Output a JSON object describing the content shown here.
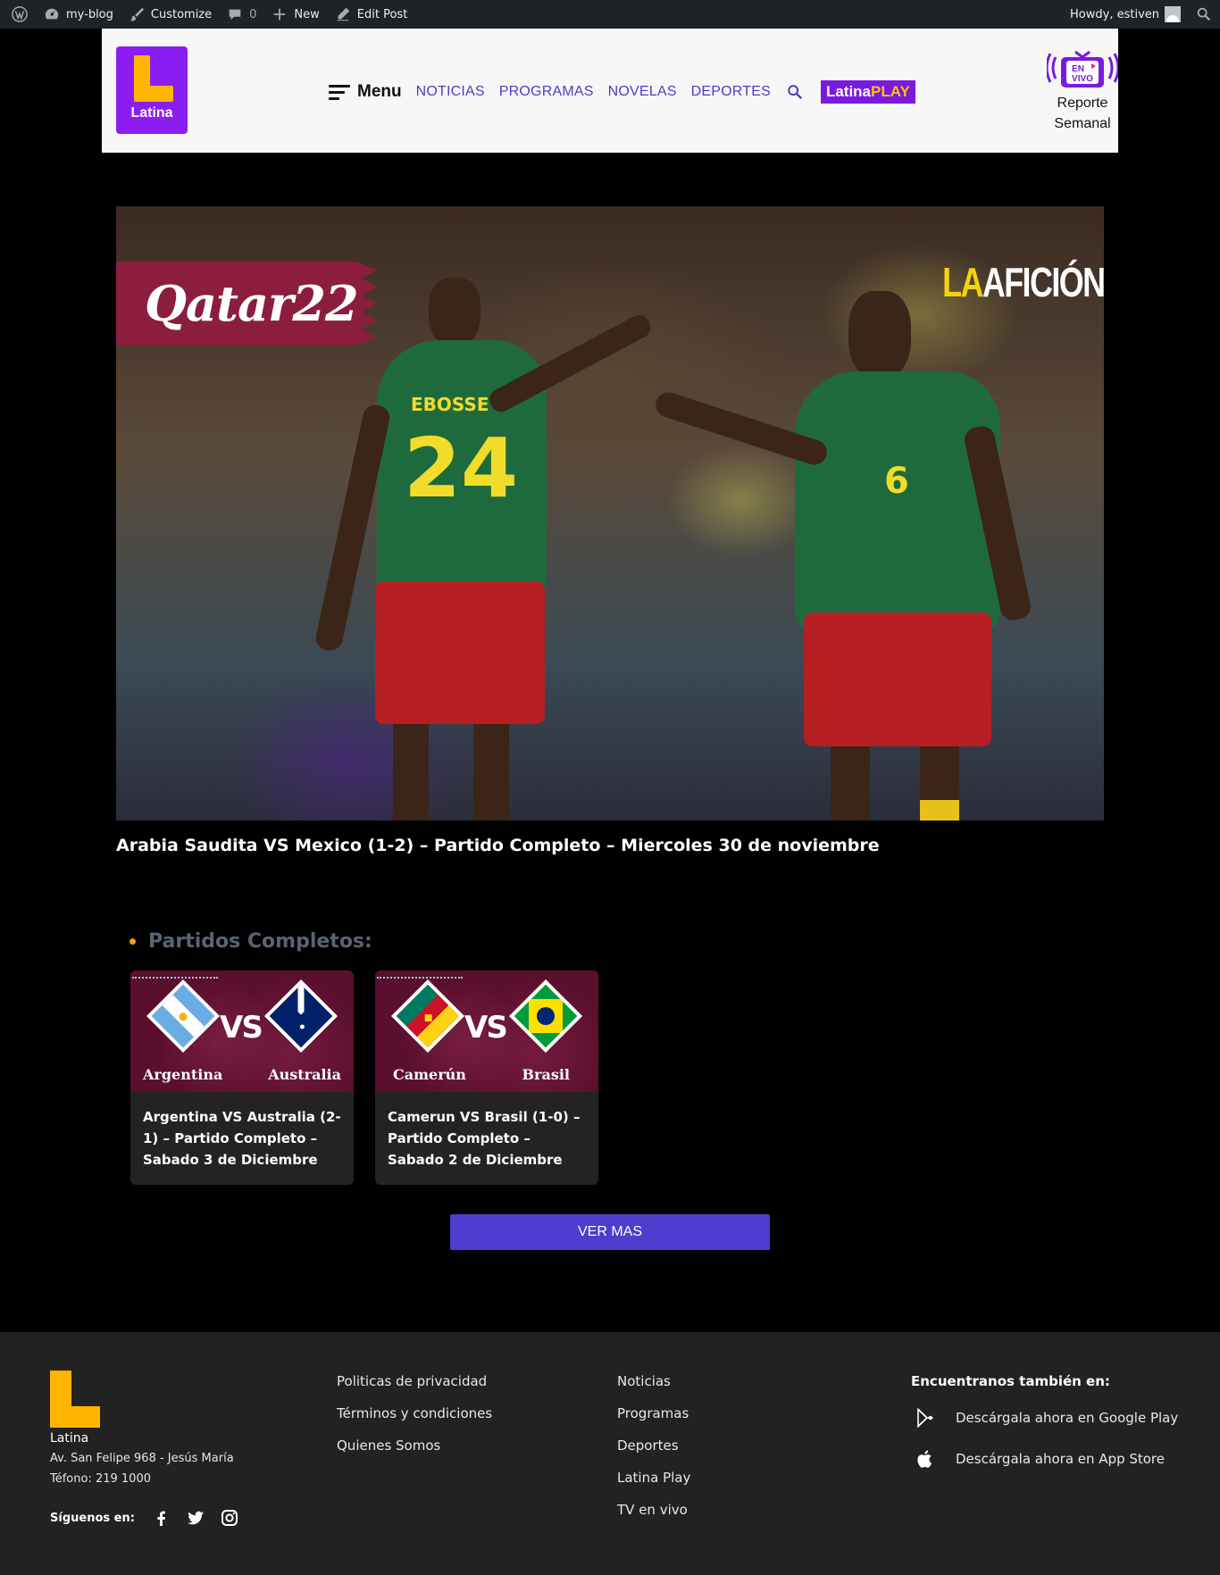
{
  "adminbar": {
    "site": "my-blog",
    "customize": "Customize",
    "comments_count": "0",
    "new": "New",
    "edit": "Edit Post",
    "howdy": "Howdy, estiven"
  },
  "header": {
    "logo_text": "Latina",
    "menu_label": "Menu",
    "nav": [
      "NOTICIAS",
      "PROGRAMAS",
      "NOVELAS",
      "DEPORTES"
    ],
    "latina_play": {
      "latina": "Latina",
      "play": "PLAY"
    },
    "en_vivo_badge": [
      "EN",
      "VIVO"
    ],
    "en_vivo_label": [
      "Reporte",
      "Semanal"
    ]
  },
  "hero": {
    "qatar_banner": "Qatar22",
    "aficion": {
      "la": "LA",
      "rest": "AFICIÓN"
    },
    "player_left_name": "EBOSSE",
    "player_left_number": "24",
    "player_right_number": "6",
    "title": "Arabia Saudita VS Mexico (1-2) – Partido Completo – Miercoles 30 de noviembre"
  },
  "section": {
    "title": "Partidos Completos:"
  },
  "cards": [
    {
      "team1": "Argentina",
      "team2": "Australia",
      "vs": "VS",
      "title": "Argentina VS Australia (2-1) – Partido Completo – Sabado 3 de Diciembre"
    },
    {
      "team1": "Camerún",
      "team2": "Brasil",
      "vs": "VS",
      "title": "Camerun VS Brasil (1-0) – Partido Completo – Sabado 2 de Diciembre"
    }
  ],
  "ver_mas": "VER MAS",
  "footer": {
    "brand": "Latina",
    "address": "Av. San Felipe 968 - Jesús María",
    "phone": "Téfono: 219 1000",
    "follow": "Síguenos en:",
    "col1": [
      "Politicas de privacidad",
      "Términos y condiciones",
      "Quienes Somos"
    ],
    "col2": [
      "Noticias",
      "Programas",
      "Deportes",
      "Latina Play",
      "TV en vivo"
    ],
    "apps_head": "Encuentranos también en:",
    "google_play": "Descárgala ahora en Google Play",
    "app_store": "Descárgala ahora en App Store"
  },
  "colors": {
    "brand_purple": "#8b1df2",
    "brand_yellow": "#ffb400",
    "nav_blue": "#4a3fc4",
    "button": "#4f3ccf"
  }
}
